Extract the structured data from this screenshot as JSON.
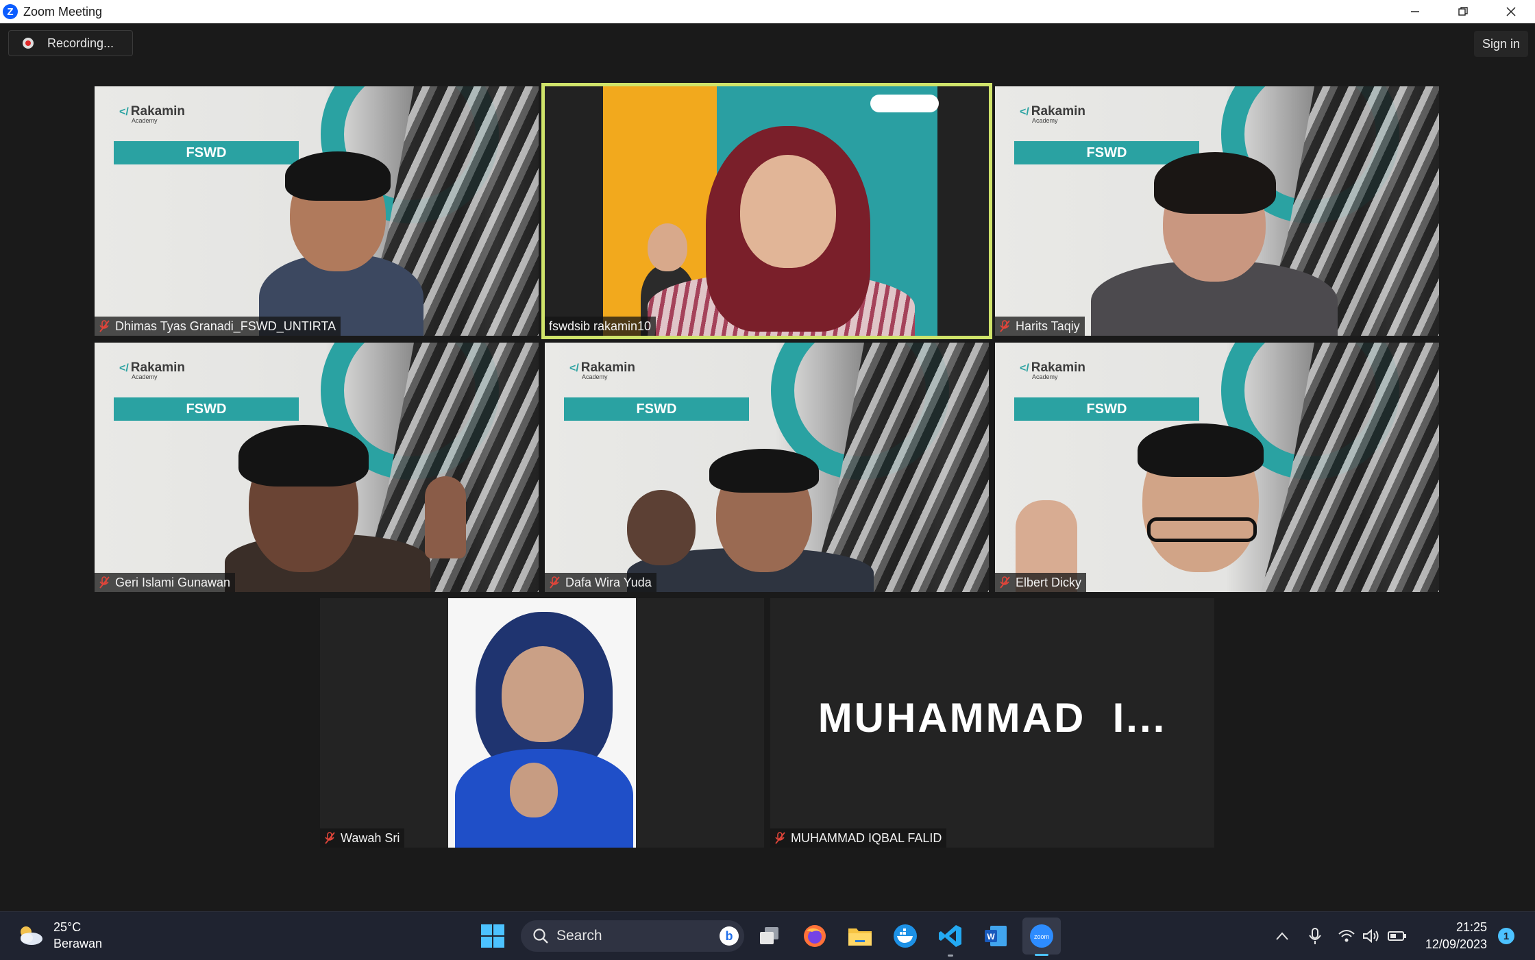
{
  "window": {
    "title": "Zoom Meeting"
  },
  "meeting": {
    "recording_label": "Recording...",
    "signin_label": "Sign in"
  },
  "slide": {
    "brand": "Rakamin",
    "brand_sub": "Academy",
    "badge": "FSWD"
  },
  "participants": [
    {
      "name": "Dhimas Tyas Granadi_FSWD_UNTIRTA",
      "muted": true
    },
    {
      "name": "fswdsib rakamin10",
      "muted": false,
      "active_speaker": true
    },
    {
      "name": "Harits Taqiy",
      "muted": true
    },
    {
      "name": "Geri Islami Gunawan",
      "muted": true
    },
    {
      "name": "Dafa Wira Yuda",
      "muted": true
    },
    {
      "name": "Elbert Dicky",
      "muted": true
    },
    {
      "name": "Wawah Sri",
      "muted": true
    },
    {
      "name": "MUHAMMAD IQBAL FALID",
      "muted": true,
      "video_off": true,
      "display_text": "MUHAMMAD  I..."
    }
  ],
  "taskbar": {
    "weather_temp": "25°C",
    "weather_desc": "Berawan",
    "search_label": "Search",
    "time": "21:25",
    "date": "12/09/2023",
    "notification_count": "1"
  },
  "colors": {
    "active_speaker": "#cfe36a",
    "slide_teal": "#2aa2a2",
    "muted_icon": "#e0453a",
    "zoom_blue": "#0b5cff"
  }
}
